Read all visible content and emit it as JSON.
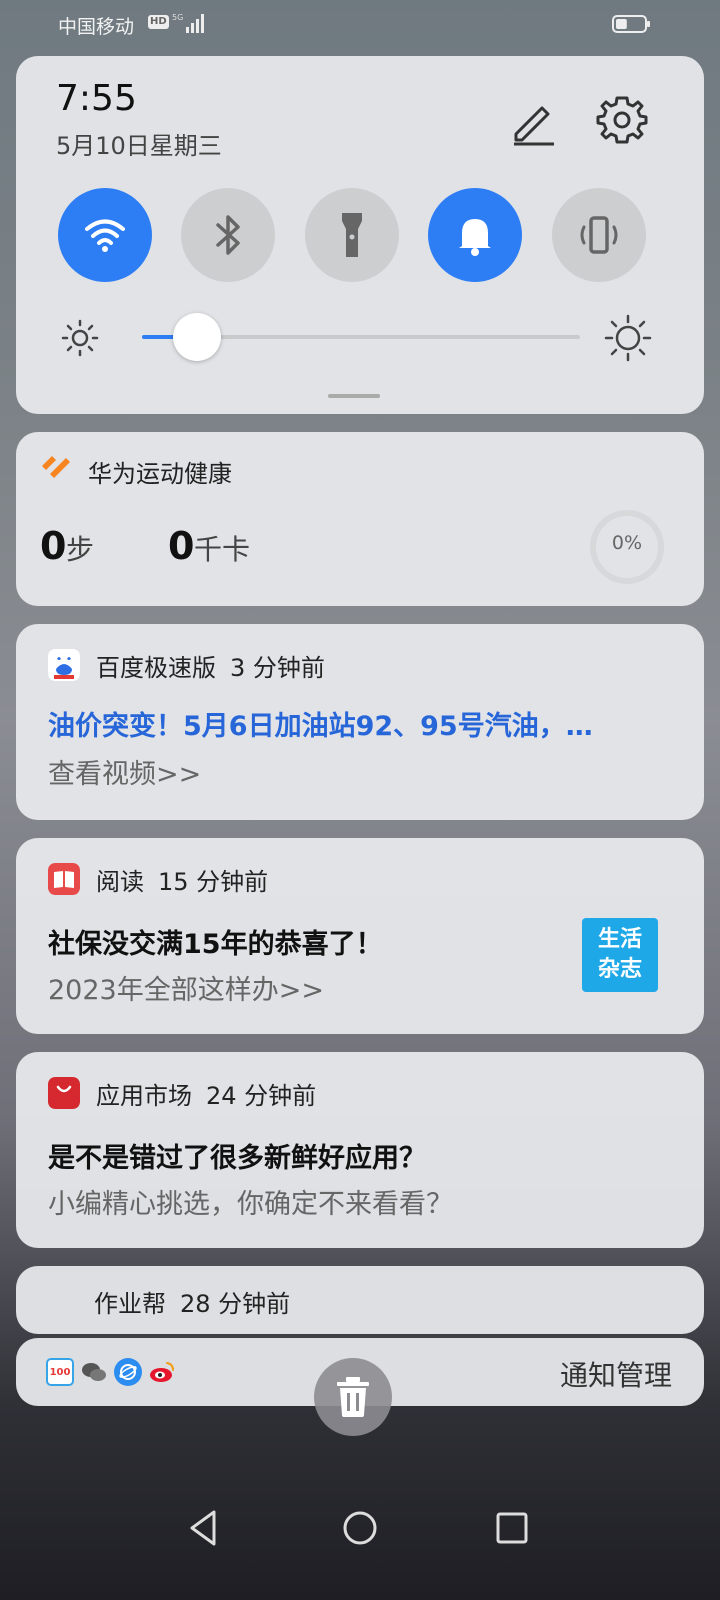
{
  "status_bar": {
    "carrier": "中国移动",
    "hd": "HD",
    "network": "5G",
    "battery_level": 0.4
  },
  "quick_settings": {
    "time": "7:55",
    "date": "5月10日星期三",
    "toggles": [
      {
        "name": "wifi",
        "on": true
      },
      {
        "name": "bluetooth",
        "on": false
      },
      {
        "name": "flashlight",
        "on": false
      },
      {
        "name": "sound",
        "on": true
      },
      {
        "name": "vibration",
        "on": false
      }
    ],
    "brightness_level": 0.09,
    "accent_color": "#2d7df4"
  },
  "health": {
    "app_name": "华为运动健康",
    "steps_value": "0",
    "steps_unit": "步",
    "calories_value": "0",
    "calories_unit": "千卡",
    "progress_label": "0%"
  },
  "notifications": [
    {
      "app": "百度极速版",
      "time": "3 分钟前",
      "title": "油价突变！5月6日加油站92、95号汽油，…",
      "body": "查看视频>>",
      "title_color": "#2766d8"
    },
    {
      "app": "阅读",
      "time": "15 分钟前",
      "title": "社保没交满15年的恭喜了！",
      "body": "2023年全部这样办>>",
      "thumb_line1": "生活",
      "thumb_line2": "杂志"
    },
    {
      "app": "应用市场",
      "time": "24 分钟前",
      "title": "是不是错过了很多新鲜好应用？",
      "body": "小编精心挑选，你确定不来看看？"
    },
    {
      "app": "作业帮",
      "time": "28 分钟前"
    }
  ],
  "bottom_bar": {
    "icons": [
      "100-icon",
      "wechat-icon",
      "browser-icon",
      "weibo-icon"
    ],
    "icon_100_text": "100",
    "manage_label": "通知管理"
  }
}
